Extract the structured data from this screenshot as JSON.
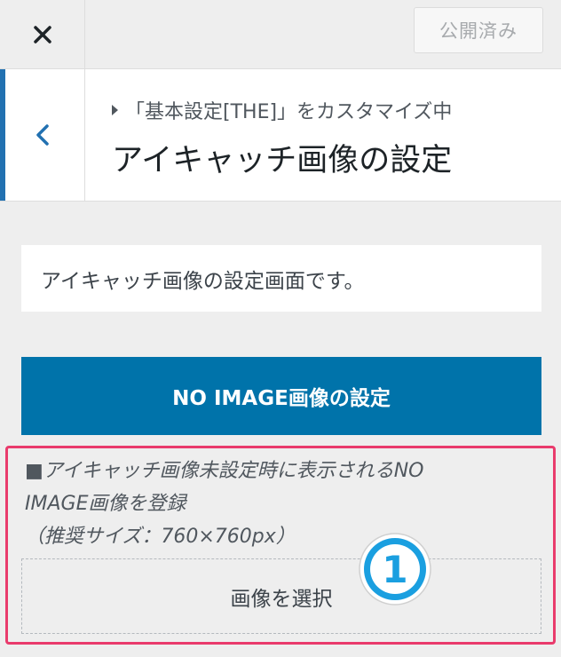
{
  "header": {
    "publish_label": "公開済み"
  },
  "section": {
    "breadcrumb": "「基本設定[THE]」をカスタマイズ中",
    "title": "アイキャッチ画像の設定"
  },
  "main": {
    "description": "アイキャッチ画像の設定画面です。",
    "noimage_button_label": "NO IMAGE画像の設定",
    "note_line1": "■アイキャッチ画像未設定時に表示されるNO",
    "note_line2": "IMAGE画像を登録",
    "note_line3": "（推奨サイズ：760×760px）",
    "select_image_label": "画像を選択",
    "step_number": "1"
  },
  "colors": {
    "accent": "#2271b1",
    "primary_button": "#0073aa",
    "highlight_border": "#e93b6c",
    "badge": "#1a9fe0"
  }
}
